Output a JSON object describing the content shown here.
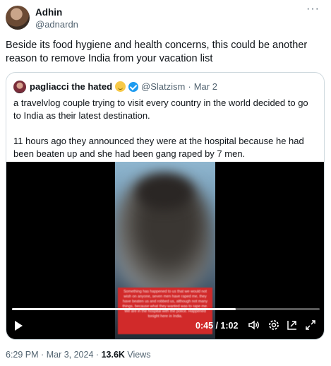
{
  "tweet": {
    "author_name": "Adhin",
    "author_handle": "@adnardn",
    "more_label": "···",
    "text": "Beside its food hygiene and health concerns, this could be another reason to remove India from your vacation list"
  },
  "quote": {
    "author_name": "pagliacci the hated",
    "author_handle": "@Slatzism",
    "separator": "·",
    "date": "Mar 2",
    "paragraph1": "a travelvlog couple trying to visit every country in the world decided to go to India as their latest destination.",
    "paragraph2": "11 hours ago they announced they were at the hospital because he had been beaten up and she had been gang raped by 7 men."
  },
  "video": {
    "caption": "Something has happened to us that we would not wish on anyone, seven men have raped me, they have beaten us and robbed us, although not many things, because what they wanted was to rape me. We are in the hospital with the police. Happened tonight here in India.",
    "current_time": "0:45",
    "duration": "1:02",
    "time_display": "0:45 / 1:02",
    "progress": 0.726
  },
  "footer": {
    "time": "6:29 PM",
    "dot1": "·",
    "date": "Mar 3, 2024",
    "dot2": "·",
    "views_count": "13.6K",
    "views_label": "Views"
  }
}
